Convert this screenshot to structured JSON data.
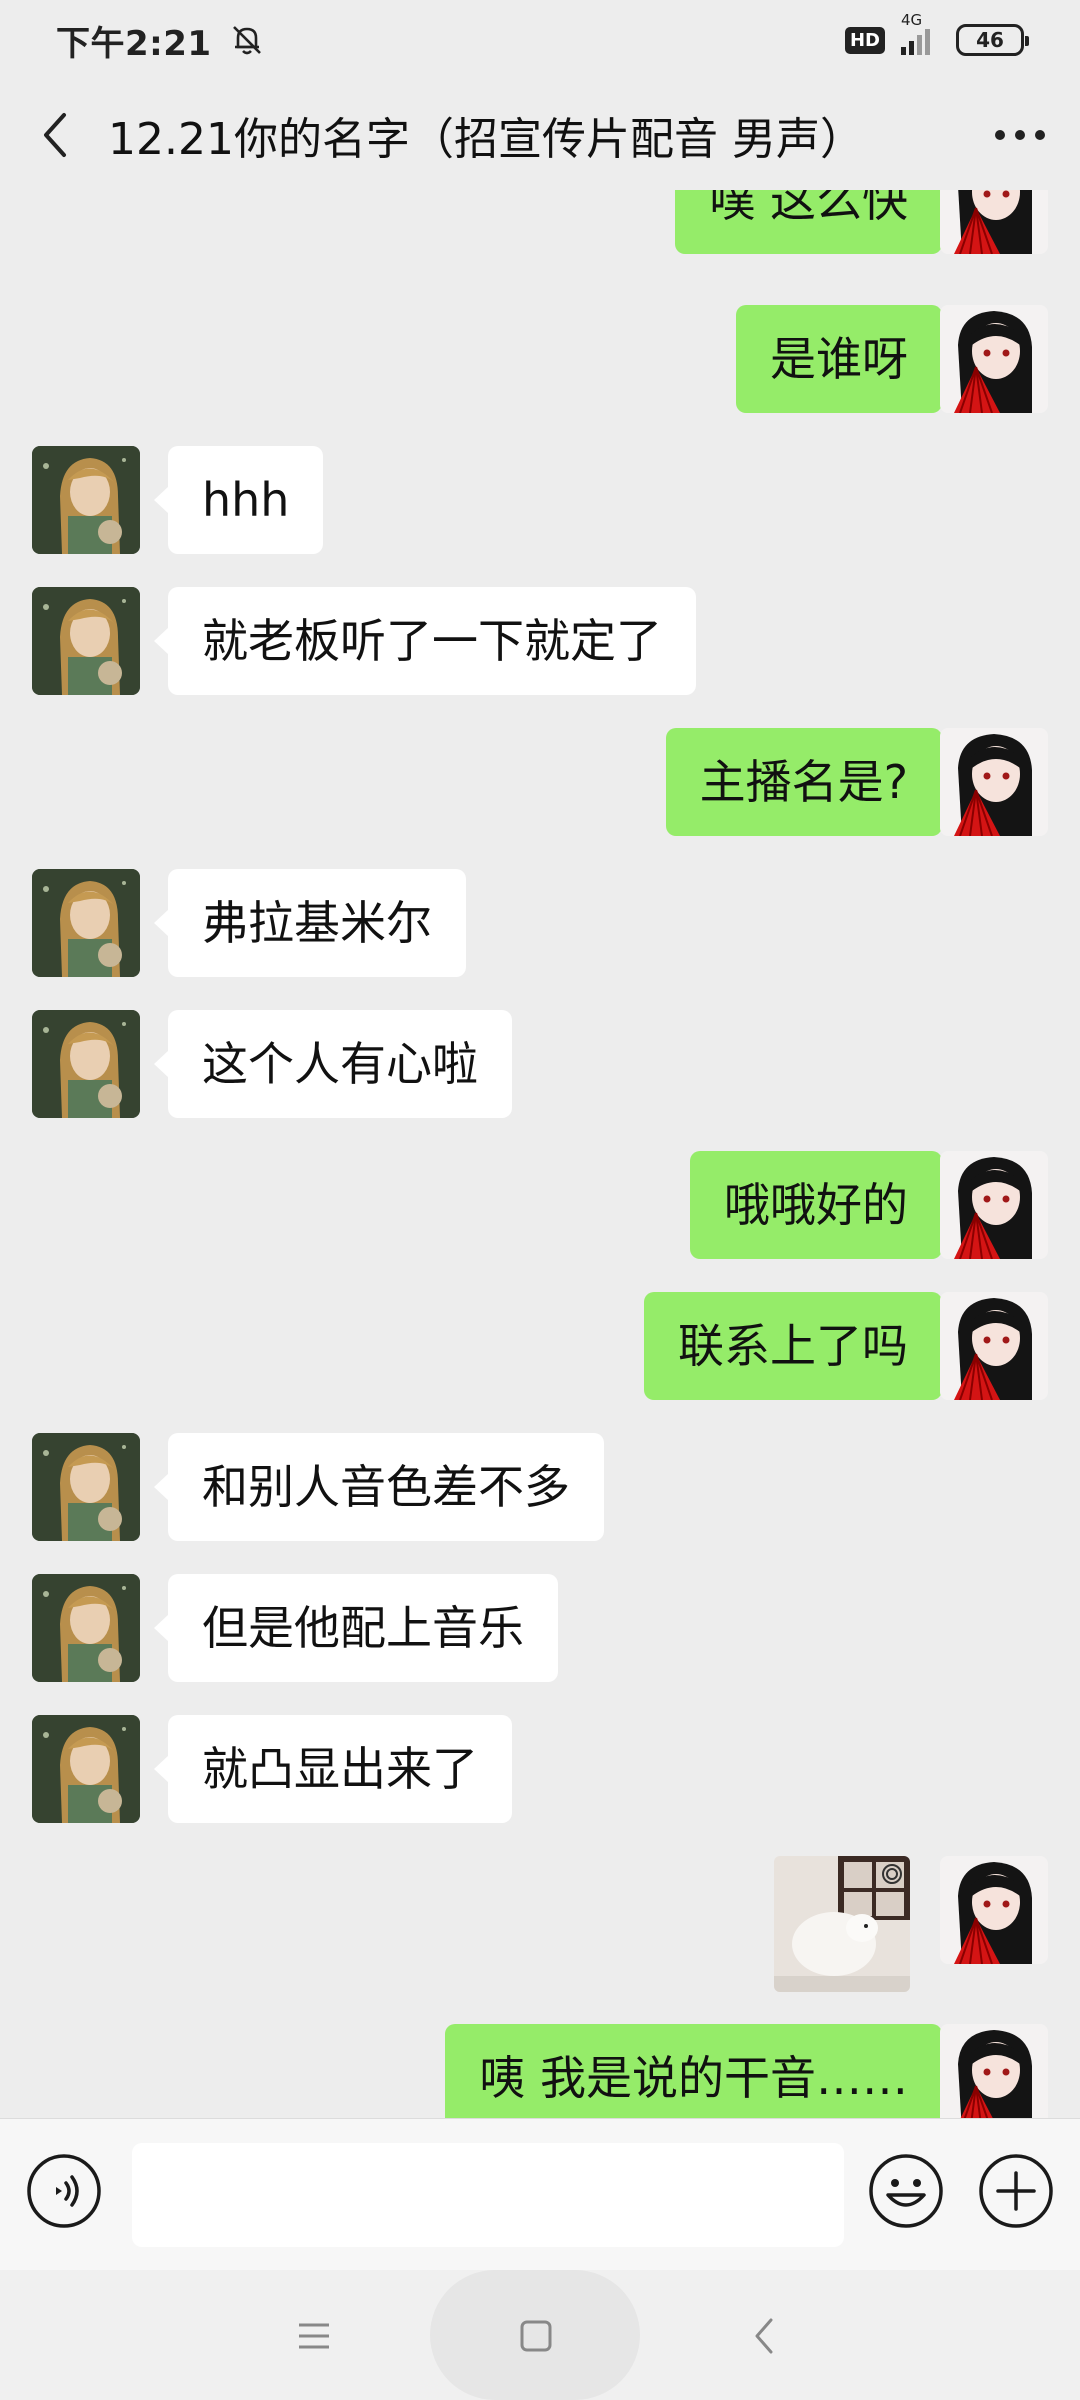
{
  "status_bar": {
    "time": "下午2:21",
    "hd": "HD",
    "network": "4G",
    "battery": "46"
  },
  "header": {
    "title": "12.21你的名字（招宣传片配音 男声）"
  },
  "messages": [
    {
      "side": "right",
      "type": "text",
      "text": "噗 这么快"
    },
    {
      "side": "right",
      "type": "text",
      "text": "是谁呀"
    },
    {
      "side": "left",
      "type": "text",
      "text": "hhh"
    },
    {
      "side": "left",
      "type": "text",
      "text": "就老板听了一下就定了"
    },
    {
      "side": "right",
      "type": "text",
      "text": "主播名是?"
    },
    {
      "side": "left",
      "type": "text",
      "text": "弗拉基米尔"
    },
    {
      "side": "left",
      "type": "text",
      "text": "这个人有心啦"
    },
    {
      "side": "right",
      "type": "text",
      "text": "哦哦好的"
    },
    {
      "side": "right",
      "type": "text",
      "text": "联系上了吗"
    },
    {
      "side": "left",
      "type": "text",
      "text": "和别人音色差不多"
    },
    {
      "side": "left",
      "type": "text",
      "text": "但是他配上音乐"
    },
    {
      "side": "left",
      "type": "text",
      "text": "就凸显出来了"
    },
    {
      "side": "right",
      "type": "sticker",
      "text": ""
    },
    {
      "side": "right",
      "type": "text",
      "text": "咦 我是说的干音……"
    }
  ],
  "input_bar": {
    "voice_icon": "voice-icon",
    "emoji_icon": "emoji-icon",
    "plus_icon": "plus-icon"
  },
  "nav": {
    "menu_icon": "menu-icon",
    "home_icon": "home-icon",
    "back_icon": "back-icon"
  },
  "colors": {
    "background": "#ededed",
    "sent_bubble": "#95ec69",
    "received_bubble": "#ffffff"
  }
}
